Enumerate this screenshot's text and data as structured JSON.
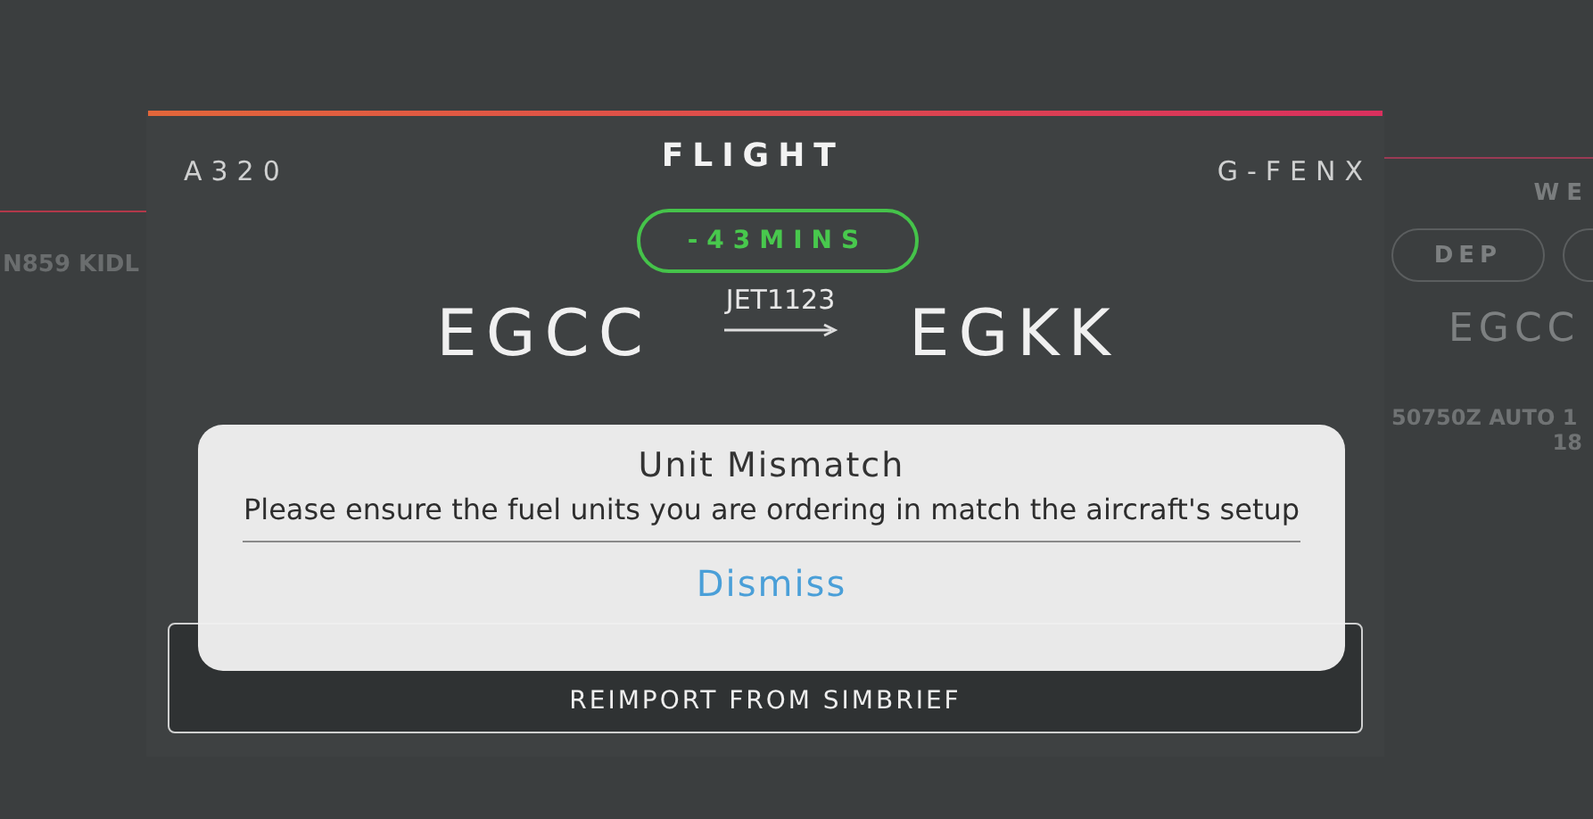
{
  "left_panel": {
    "route": "N859 KIDL"
  },
  "flight_card": {
    "title": "FLIGHT",
    "aircraft": "A320",
    "registration": "G-FENX",
    "delay_badge": "-43MINS",
    "callsign": "JET1123",
    "origin": "EGCC",
    "destination": "EGKK",
    "reimport_button": "REIMPORT FROM SIMBRIEF"
  },
  "right_panel": {
    "heading": "WE",
    "tabs": [
      {
        "label": "DEP",
        "selected": false
      },
      {
        "selected": false
      }
    ],
    "airport": "EGCC",
    "metar": "50750Z AUTO 1",
    "metar_line_2": "18"
  },
  "alert": {
    "title": "Unit Mismatch",
    "message": "Please ensure the fuel units you are ordering in match the aircraft's setup",
    "button": "Dismiss"
  }
}
